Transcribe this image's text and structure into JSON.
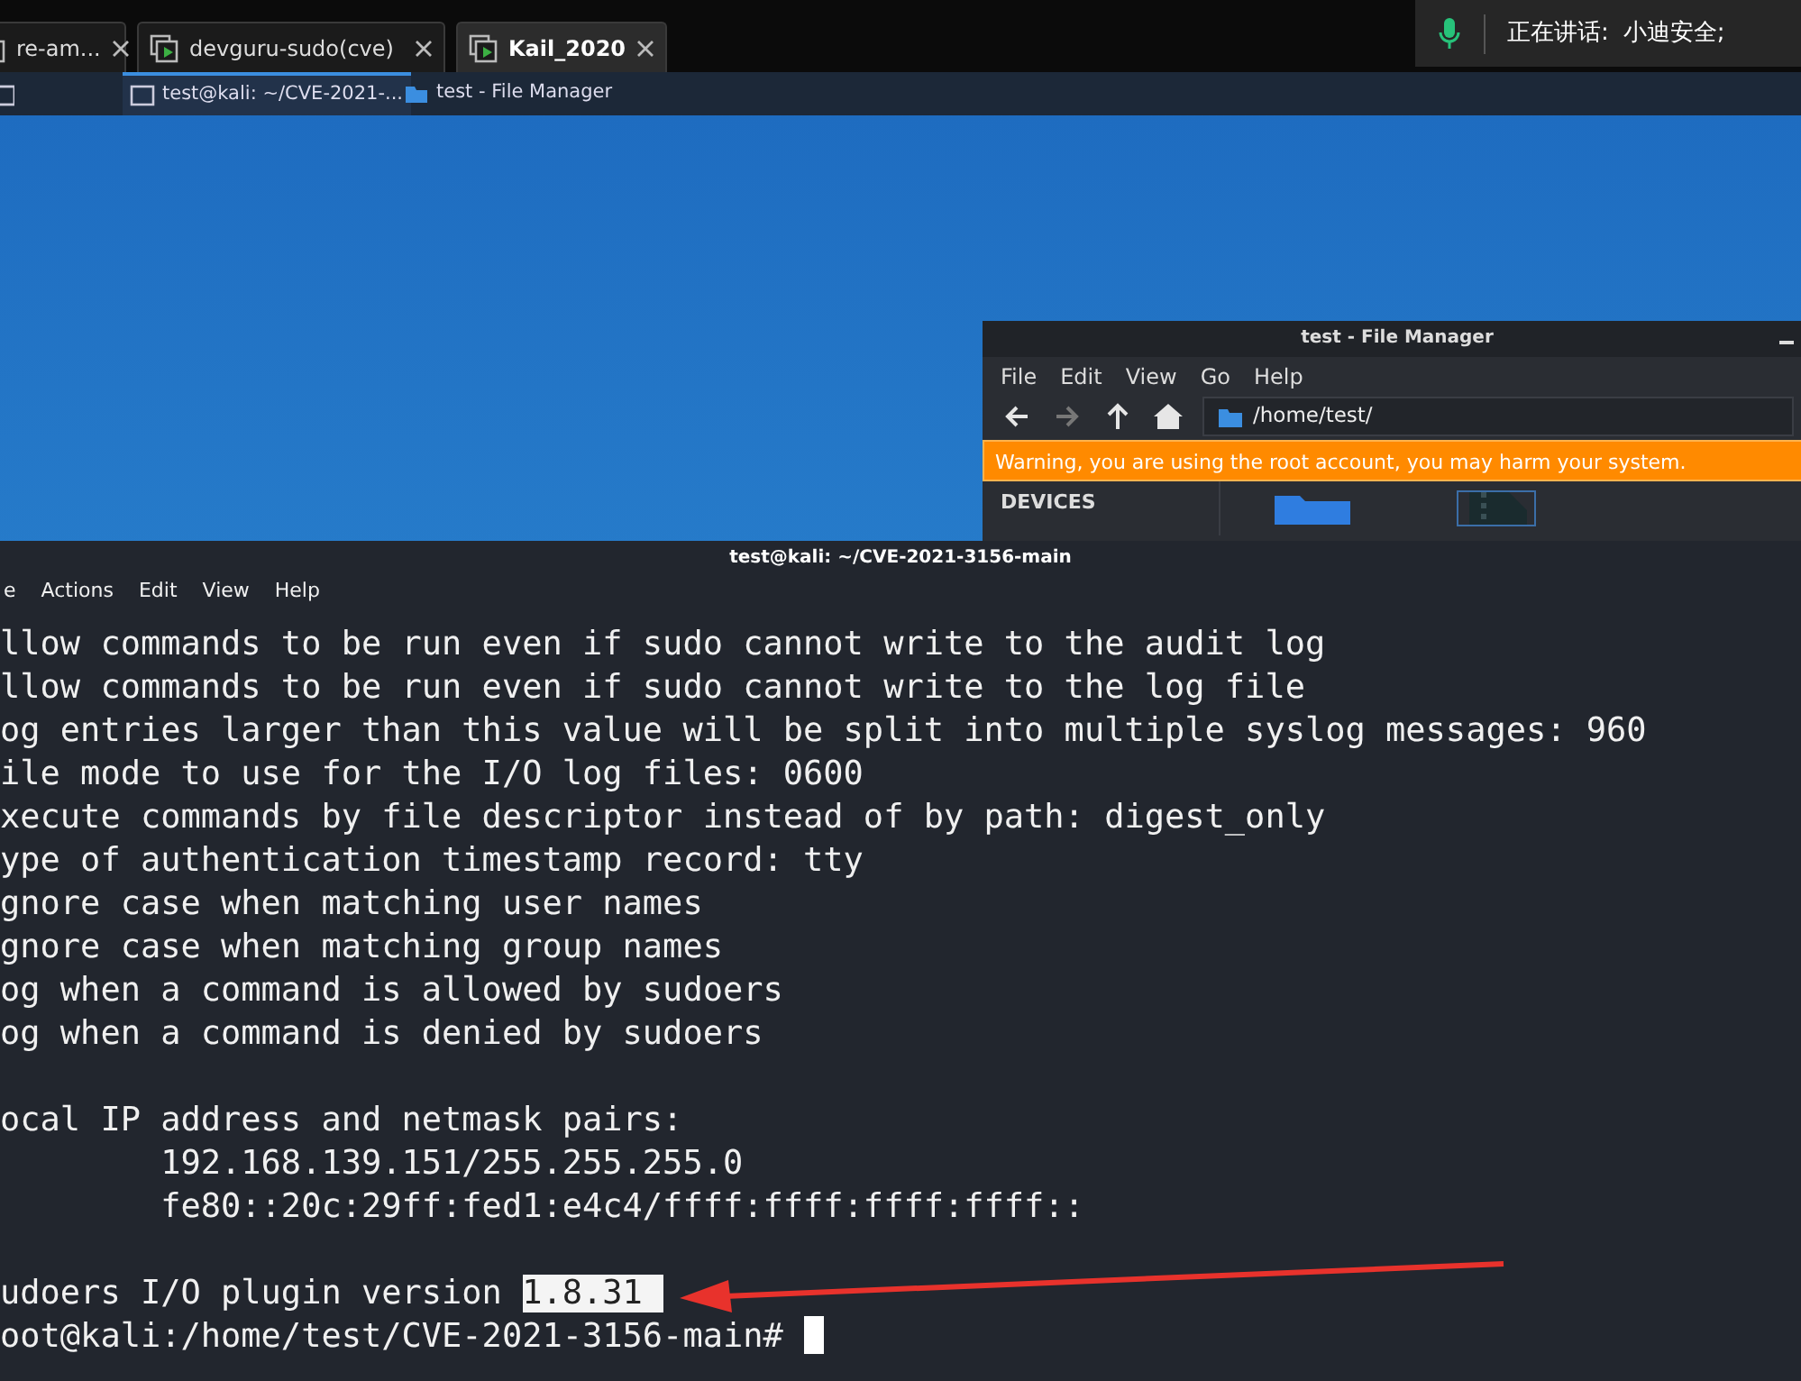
{
  "vm_tabs": [
    {
      "label": "re-am...",
      "selected": false
    },
    {
      "label": "devguru-sudo(cve)",
      "selected": false
    },
    {
      "label": "Kail_2020",
      "selected": true
    }
  ],
  "speaking": {
    "label": "正在讲话:",
    "speaker": "小迪安全;"
  },
  "taskbar": [
    {
      "label": "test@kali: ~/CVE-2021-...",
      "kind": "terminal",
      "selected": true
    },
    {
      "label": "test - File Manager",
      "kind": "folder",
      "selected": false
    }
  ],
  "file_manager": {
    "title": "test - File Manager",
    "menu": [
      "File",
      "Edit",
      "View",
      "Go",
      "Help"
    ],
    "toolbar": [
      {
        "kind": "back",
        "disabled": false
      },
      {
        "kind": "forward",
        "disabled": true
      },
      {
        "kind": "up",
        "disabled": false
      },
      {
        "kind": "home",
        "disabled": false
      }
    ],
    "path": "/home/test/",
    "warning": "Warning, you are using the root account, you may harm your system.",
    "sidebar_header": "DEVICES",
    "items": [
      {
        "kind": "folder",
        "selected": false
      },
      {
        "kind": "archive",
        "selected": true
      }
    ]
  },
  "terminal": {
    "title": "test@kali: ~/CVE-2021-3156-main",
    "menu": [
      "e",
      "Actions",
      "Edit",
      "View",
      "Help"
    ],
    "blocks": [
      [
        "llow commands to be run even if sudo cannot write to the audit log",
        "llow commands to be run even if sudo cannot write to the log file",
        "og entries larger than this value will be split into multiple syslog messages: 960",
        "ile mode to use for the I/O log files: 0600",
        "xecute commands by file descriptor instead of by path: digest_only",
        "ype of authentication timestamp record: tty",
        "gnore case when matching user names",
        "gnore case when matching group names",
        "og when a command is allowed by sudoers",
        "og when a command is denied by sudoers"
      ],
      [
        "ocal IP address and netmask pairs:",
        "        192.168.139.151/255.255.255.0",
        "        fe80::20c:29ff:fed1:e4c4/ffff:ffff:ffff:ffff::"
      ]
    ],
    "version_line": {
      "text": "udoers I/O plugin version ",
      "selection": "1.8.31"
    },
    "prompt": "oot@kali:/home/test/CVE-2021-3156-main# "
  }
}
